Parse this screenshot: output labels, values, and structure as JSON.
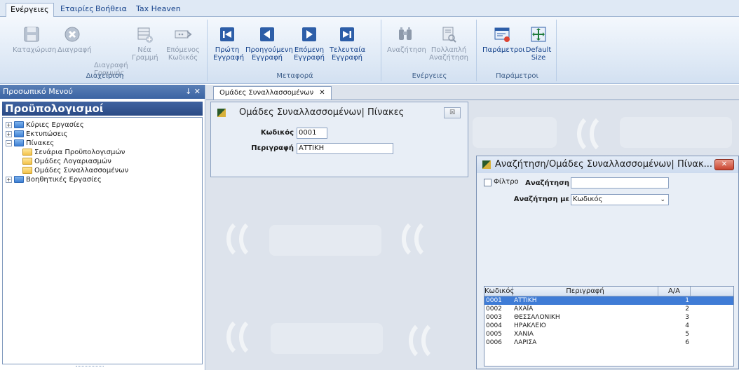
{
  "menu": {
    "tabs": [
      "Ενέργειες",
      "Εταιρίες",
      "Βοήθεια",
      "Tax Heaven"
    ]
  },
  "ribbon": {
    "groups": [
      {
        "label": "Διαχείριση",
        "buttons": [
          {
            "label": "Καταχώριση",
            "icon": "save-icon"
          },
          {
            "label": "Διαγραφή",
            "icon": "delete-icon"
          },
          {
            "label": "Διαγραφή\nΓραμμής",
            "icon": "delete-row-icon"
          },
          {
            "label": "Νέα\nΓραμμή",
            "icon": "new-row-icon"
          },
          {
            "label": "Επόμενος\nΚωδικός",
            "icon": "next-code-icon"
          }
        ]
      },
      {
        "label": "Μεταφορά",
        "buttons": [
          {
            "label": "Πρώτη\nΕγγραφή",
            "icon": "first-record-icon"
          },
          {
            "label": "Προηγούμενη\nΕγγραφή",
            "icon": "previous-record-icon"
          },
          {
            "label": "Επόμενη\nΕγγραφή",
            "icon": "next-record-icon"
          },
          {
            "label": "Τελευταία\nΕγγραφή",
            "icon": "last-record-icon"
          }
        ]
      },
      {
        "label": "Ενέργειες",
        "buttons": [
          {
            "label": "Αναζήτηση",
            "icon": "binoculars-icon"
          },
          {
            "label": "Πολλαπλή\nΑναζήτηση",
            "icon": "multi-search-icon"
          }
        ]
      },
      {
        "label": "Παράμετροι",
        "buttons": [
          {
            "label": "Παράμετροι",
            "icon": "parameters-icon"
          },
          {
            "label": "Default\nSize",
            "icon": "default-size-icon"
          }
        ]
      }
    ]
  },
  "left_panel": {
    "header": "Προσωπικό Μενού",
    "header_icons": "↓ ✕",
    "title": "Προϋπολογισμοί",
    "tree": [
      {
        "label": "Κύριες Εργασίες",
        "expander": "+",
        "depth": 0,
        "folder": "blue"
      },
      {
        "label": "Εκτυπώσεις",
        "expander": "+",
        "depth": 0,
        "folder": "blue"
      },
      {
        "label": "Πίνακες",
        "expander": "−",
        "depth": 0,
        "folder": "blue"
      },
      {
        "label": "Σενάρια Προϋπολογισμών",
        "expander": "",
        "depth": 1,
        "folder": "yellow"
      },
      {
        "label": "Ομάδες Λογαριασμών",
        "expander": "",
        "depth": 1,
        "folder": "yellow"
      },
      {
        "label": "Ομάδες Συναλλασσομένων",
        "expander": "",
        "depth": 1,
        "folder": "yellow"
      },
      {
        "label": "Βοηθητικές Εργασίες",
        "expander": "+",
        "depth": 0,
        "folder": "blue"
      }
    ]
  },
  "doc_tab": {
    "label": "Ομάδες Συναλλασσομένων",
    "close": "✕"
  },
  "form": {
    "title": "Ομάδες Συναλλασσομένων| Πίνακες",
    "close": "☒",
    "code_label": "Κωδικός",
    "code_value": "0001",
    "desc_label": "Περιγραφή",
    "desc_value": "ΑΤΤΙΚΗ"
  },
  "search_window": {
    "title": "Αναζήτηση/Ομάδες Συναλλασσομένων| Πίνακ...",
    "close": "✕",
    "filter_label": "Φίλτρο",
    "search_label": "Αναζήτηση",
    "search_value": "",
    "search_by_label": "Αναζήτηση με",
    "search_by_value": "Κωδικός",
    "columns": [
      "Κωδικός",
      "Περιγραφή",
      "Α/Α"
    ],
    "rows": [
      {
        "code": "0001",
        "desc": "ΑΤΤΙΚΗ",
        "aa": "1"
      },
      {
        "code": "0002",
        "desc": "ΑΧΑΪΑ",
        "aa": "2"
      },
      {
        "code": "0003",
        "desc": "ΘΕΣΣΑΛΟΝΙΚΗ",
        "aa": "3"
      },
      {
        "code": "0004",
        "desc": "ΗΡΑΚΛΕΙΟ",
        "aa": "4"
      },
      {
        "code": "0005",
        "desc": "ΧΑΝΙΑ",
        "aa": "5"
      },
      {
        "code": "0006",
        "desc": "ΛΑΡΙΣΑ",
        "aa": "6"
      }
    ],
    "selected_index": 0
  },
  "colors": {
    "selection": "#3f7cd6",
    "panel_header": "#3b64a3",
    "ribbon_text": "#15428b"
  }
}
